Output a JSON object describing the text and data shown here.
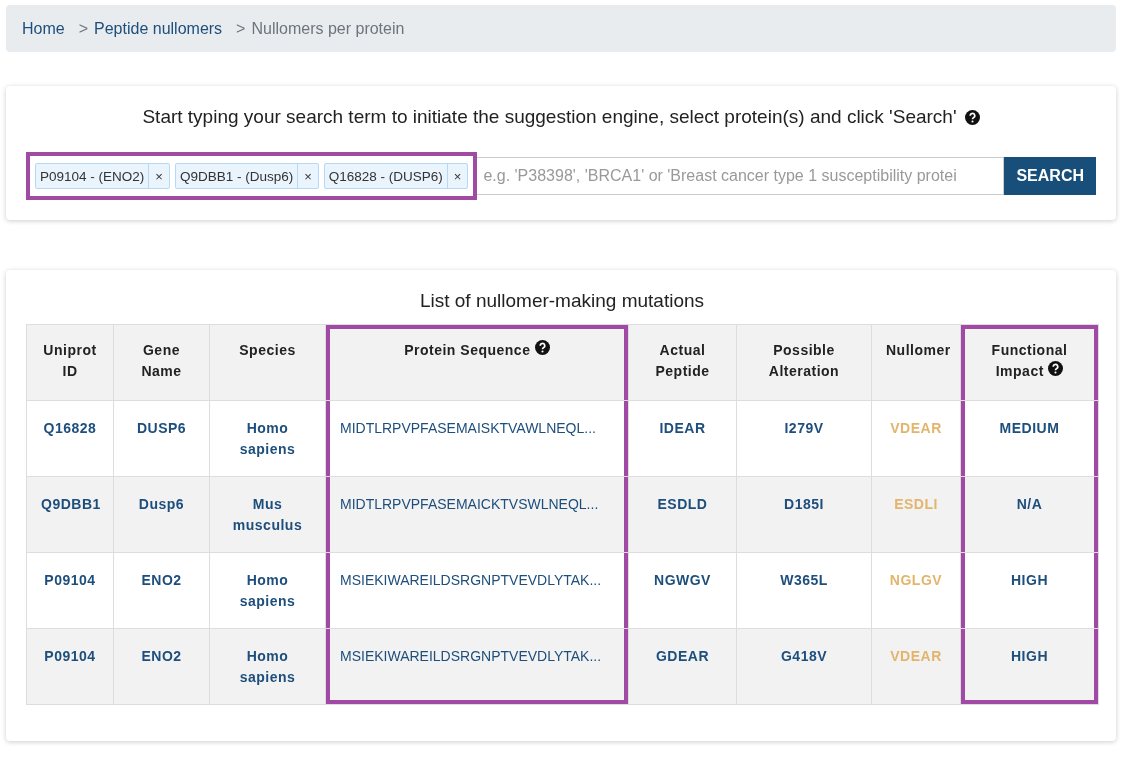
{
  "breadcrumb": [
    {
      "label": "Home",
      "current": false
    },
    {
      "prefix": ">",
      "label": "Peptide nullomers",
      "current": false
    },
    {
      "prefix": ">",
      "label": "Nullomers per protein",
      "current": true
    }
  ],
  "search": {
    "instructions": "Start typing your search term to initiate the suggestion engine, select protein(s) and click 'Search'",
    "help": true,
    "highlighted": true,
    "tags": [
      {
        "label": "P09104 - (ENO2)",
        "remove": "×"
      },
      {
        "label": "Q9DBB1 - (Dusp6)",
        "remove": "×"
      },
      {
        "label": "Q16828 - (DUSP6)",
        "remove": "×"
      }
    ],
    "placeholder": "e.g. 'P38398', 'BRCA1' or 'Breast cancer type 1 susceptibility protei",
    "button": "SEARCH"
  },
  "table": {
    "title": "List of nullomer-making mutations",
    "columns": [
      {
        "label": "Uniprot ID",
        "kind": "plain",
        "help": false,
        "highlighted": false
      },
      {
        "label": "Gene Name",
        "kind": "plain",
        "help": false,
        "highlighted": false
      },
      {
        "label": "Species",
        "kind": "plain",
        "help": false,
        "highlighted": false
      },
      {
        "label": "Protein Sequence",
        "kind": "sequence",
        "help": true,
        "highlighted": true
      },
      {
        "label": "Actual Peptide",
        "kind": "plain",
        "help": false,
        "highlighted": false
      },
      {
        "label": "Possible Alteration",
        "kind": "plain",
        "help": false,
        "highlighted": false
      },
      {
        "label": "Nullomer",
        "kind": "nullomer",
        "help": false,
        "highlighted": false
      },
      {
        "label": "Functional Impact",
        "kind": "plain",
        "help": true,
        "highlighted": true
      }
    ],
    "rows": [
      [
        "Q16828",
        "DUSP6",
        "Homo sapiens",
        "MIDTLRPVPFASEMAISKTVAWLNEQL...",
        "IDEAR",
        "I279V",
        "VDEAR",
        "MEDIUM"
      ],
      [
        "Q9DBB1",
        "Dusp6",
        "Mus musculus",
        "MIDTLRPVPFASEMAICKTVSWLNEQL...",
        "ESDLD",
        "D185I",
        "ESDLI",
        "N/A"
      ],
      [
        "P09104",
        "ENO2",
        "Homo sapiens",
        "MSIEKIWAREILDSRGNPTVEVDLYTAK...",
        "NGWGV",
        "W365L",
        "NGLGV",
        "HIGH"
      ],
      [
        "P09104",
        "ENO2",
        "Homo sapiens",
        "MSIEKIWAREILDSRGNPTVEVDLYTAK...",
        "GDEAR",
        "G418V",
        "VDEAR",
        "HIGH"
      ]
    ]
  }
}
